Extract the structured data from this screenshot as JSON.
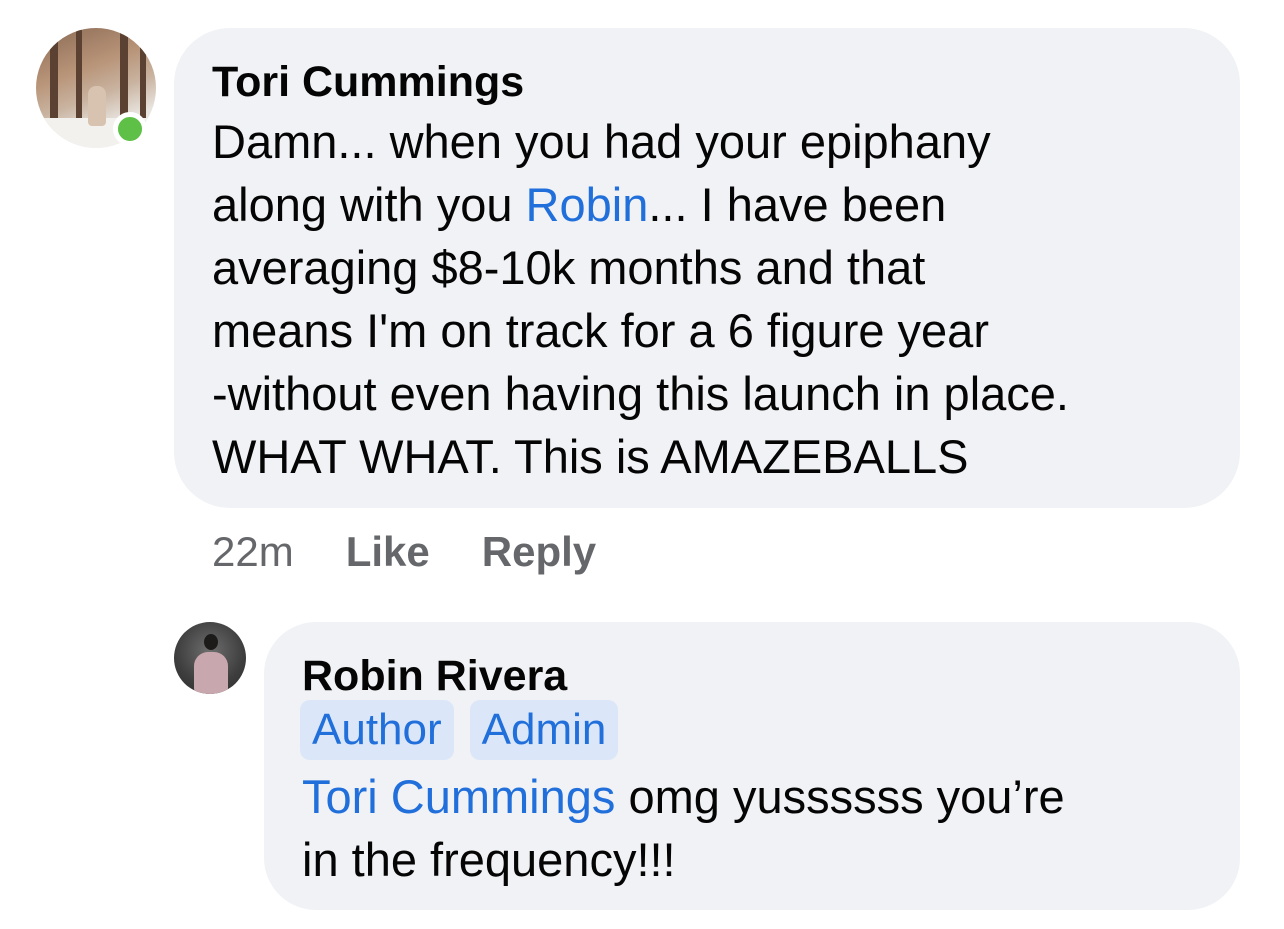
{
  "comment": {
    "author": "Tori Cummings",
    "online": true,
    "lines": [
      {
        "pre": "Damn... when you had your epiphany",
        "mention": "",
        "post": ""
      },
      {
        "pre": "along with you ",
        "mention": "Robin",
        "post": "... I have been"
      },
      {
        "pre": "averaging $8-10k months and that",
        "mention": "",
        "post": ""
      },
      {
        "pre": "means I'm on track for a 6 figure year",
        "mention": "",
        "post": ""
      },
      {
        "pre": "-without even having this launch in place.",
        "mention": "",
        "post": ""
      },
      {
        "pre": "WHAT WHAT. This is AMAZEBALLS",
        "mention": "",
        "post": ""
      }
    ],
    "time": "22m",
    "like_label": "Like",
    "reply_label": "Reply"
  },
  "reply": {
    "author": "Robin Rivera",
    "badges": [
      "Author",
      "Admin"
    ],
    "mention": "Tori Cummings",
    "text_line1": " omg yussssss you’re",
    "text_line2": "in the frequency!!!"
  },
  "colors": {
    "bubble": "#f0f2f5",
    "mention": "#216fdb",
    "badge_bg": "#dbe7f9",
    "online": "#5ec047",
    "meta": "#65676b"
  }
}
